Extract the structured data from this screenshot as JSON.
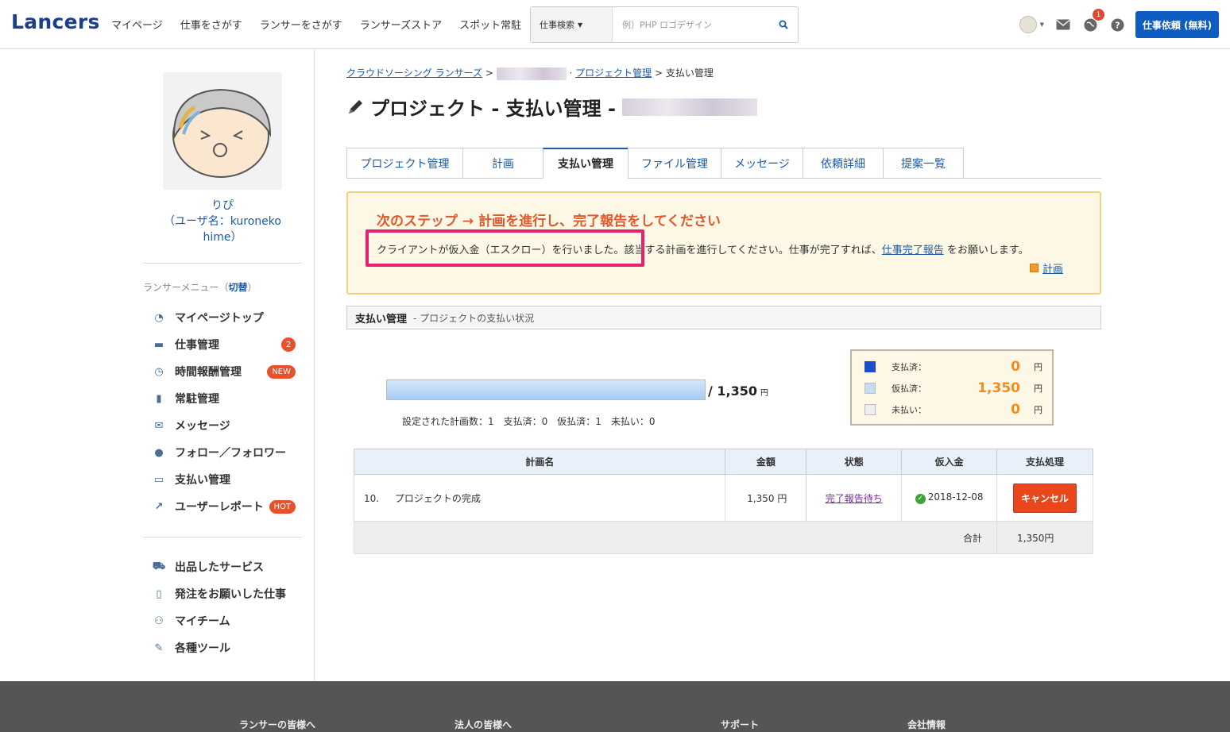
{
  "header": {
    "logo": "Lancers",
    "nav": [
      "マイページ",
      "仕事をさがす",
      "ランサーをさがす",
      "ランサーズストア",
      "スポット常駐"
    ],
    "search_select": "仕事検索",
    "search_placeholder": "例）PHP ロゴデザイン",
    "notification_count": "1",
    "cta_label": "仕事依頼 (無料)"
  },
  "sidebar": {
    "profile_name": "りぴ",
    "username_line1": "（ユーザ名：kuroneko",
    "username_line2": "hime）",
    "menu_title": "ランサーメニュー（",
    "menu_switch": "切替",
    "menu_title_end": "）",
    "items": [
      {
        "label": "マイページトップ",
        "icon": "dashboard-icon"
      },
      {
        "label": "仕事管理",
        "icon": "briefcase-icon",
        "badge": "2"
      },
      {
        "label": "時間報酬管理",
        "icon": "clock-icon",
        "badge": "NEW"
      },
      {
        "label": "常駐管理",
        "icon": "building-icon"
      },
      {
        "label": "メッセージ",
        "icon": "envelope-icon"
      },
      {
        "label": "フォロー／フォロワー",
        "icon": "user-icon"
      },
      {
        "label": "支払い管理",
        "icon": "card-icon"
      },
      {
        "label": "ユーザーレポート",
        "icon": "chart-icon",
        "badge": "HOT"
      }
    ],
    "items2": [
      {
        "label": "出品したサービス",
        "icon": "cart-icon"
      },
      {
        "label": "発注をお願いした仕事",
        "icon": "file-icon"
      },
      {
        "label": "マイチーム",
        "icon": "team-icon"
      },
      {
        "label": "各種ツール",
        "icon": "wrench-icon"
      }
    ]
  },
  "breadcrumb": {
    "root": "クラウドソーシング ランサーズ",
    "project": "プロジェクト管理",
    "current": "支払い管理"
  },
  "page_title": "プロジェクト - 支払い管理 -",
  "tabs": [
    "プロジェクト管理",
    "計画",
    "支払い管理",
    "ファイル管理",
    "メッセージ",
    "依頼詳細",
    "提案一覧"
  ],
  "notice": {
    "title": "次のステップ → 計画を進行し、完了報告をしてください",
    "text_highlight": "クライアントが仮入金（エスクロー）を行いました。",
    "text_rest": "該当する計画を進行してください。仕事が完了すれば、",
    "link": "仕事完了報告",
    "text_end": "をお願いします。",
    "plan_link": "計画"
  },
  "section": {
    "title": "支払い管理",
    "subtitle": "-  プロジェクトの支払い状況"
  },
  "progress": {
    "escrow_fraction": 1.0,
    "total": "/ 1,350",
    "unit": "円",
    "stats": "設定された計画数：1　支払済：0　仮払済：1　未払い：0"
  },
  "legend": [
    {
      "label": "支払済：",
      "value": "0",
      "unit": "円",
      "color": "#1a4fc9"
    },
    {
      "label": "仮払済：",
      "value": "1,350",
      "unit": "円",
      "color": "#c6dcf5"
    },
    {
      "label": "未払い：",
      "value": "0",
      "unit": "円",
      "color": "#eeeeee"
    }
  ],
  "table": {
    "headers": [
      "計画名",
      "金額",
      "状態",
      "仮入金",
      "支払処理"
    ],
    "row": {
      "number": "10.",
      "name": "プロジェクトの完成",
      "amount": "1,350 円",
      "status": "完了報告待ち",
      "deposit_date": "2018-12-08",
      "action": "キャンセル"
    },
    "total_label": "合計",
    "total_value": "1,350円"
  },
  "footer": [
    "ランサーの皆様へ",
    "法人の皆様へ",
    "サポート",
    "会社情報"
  ]
}
